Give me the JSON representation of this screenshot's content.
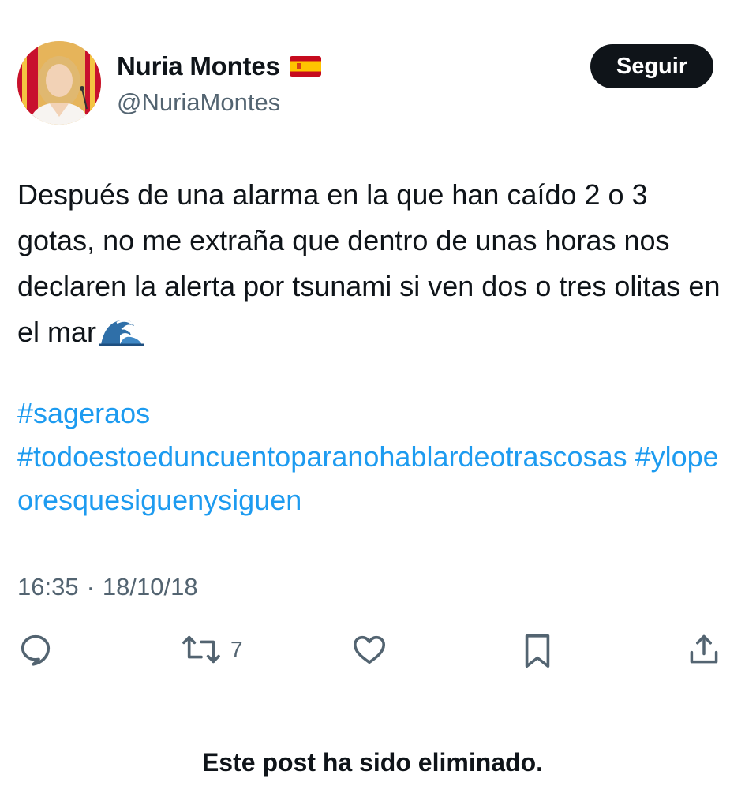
{
  "author": {
    "display_name": "Nuria Montes",
    "handle": "@NuriaMontes",
    "flag_icon": "spain-flag-icon"
  },
  "header": {
    "follow_label": "Seguir"
  },
  "tweet": {
    "text": "Después de una alarma en la que han caído 2 o 3 gotas, no me extraña que dentro de unas horas nos declaren la alerta por tsunami si ven dos o tres olitas en el mar",
    "emoji_icon": "water-wave-icon",
    "hashtags": [
      "#sageraos",
      "#todoestoeduncuentoparanohablardeotrascosas",
      "#ylopeoresquesiguenysiguen"
    ],
    "time": "16:35",
    "separator": "·",
    "date": "18/10/18"
  },
  "actions": {
    "reply_icon": "reply-icon",
    "retweet_icon": "retweet-icon",
    "retweet_count": "7",
    "like_icon": "heart-icon",
    "bookmark_icon": "bookmark-icon",
    "share_icon": "share-icon"
  },
  "footer": {
    "deleted_notice": "Este post ha sido eliminado."
  },
  "colors": {
    "text": "#0f1419",
    "secondary": "#536471",
    "link": "#1d9bf0",
    "button_bg": "#0f1419",
    "button_text": "#ffffff"
  }
}
